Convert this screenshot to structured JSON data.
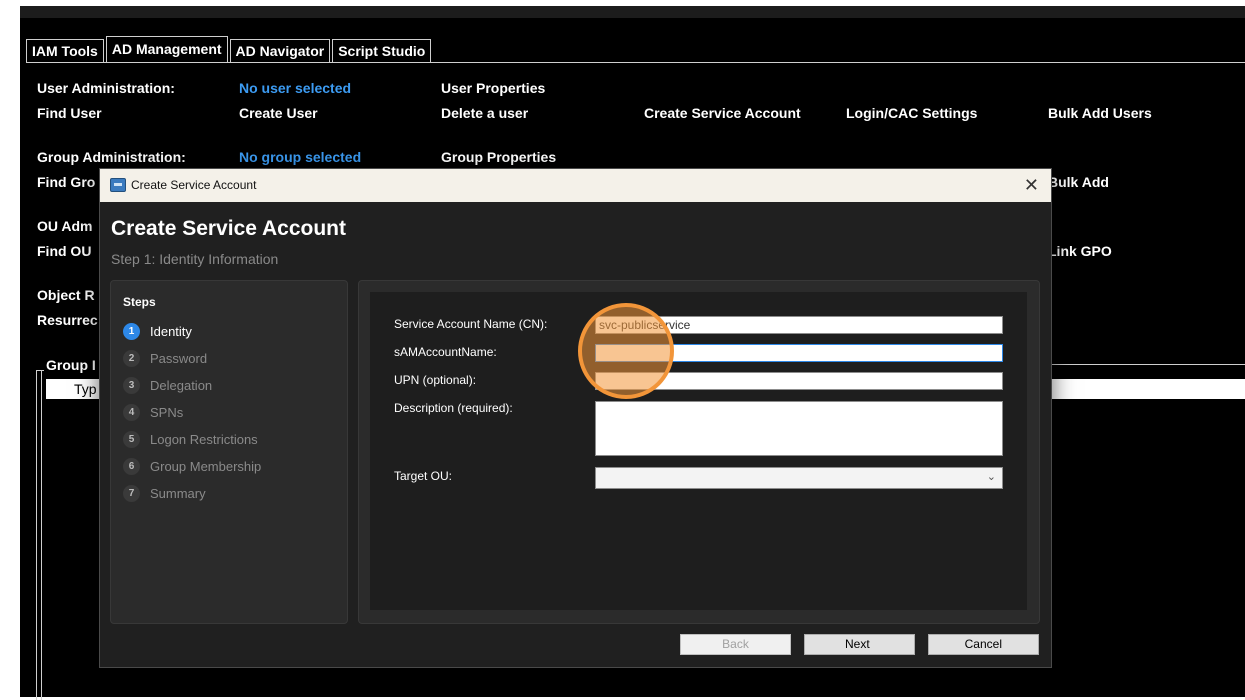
{
  "tabs": [
    "IAM Tools",
    "AD Management",
    "AD Navigator",
    "Script Studio"
  ],
  "active_tab": "AD Management",
  "user_admin": {
    "heading": "User Administration:",
    "status": "No user selected",
    "properties": "User Properties",
    "actions": [
      "Find User",
      "Create User",
      "Delete a user",
      "Create Service Account",
      "Login/CAC Settings",
      "Bulk Add Users"
    ]
  },
  "group_admin": {
    "heading": "Group Administration:",
    "status": "No group selected",
    "properties": "Group Properties",
    "find": "Find Gro",
    "bulk": "Bulk Add"
  },
  "ou_admin": {
    "heading": "OU Adm",
    "find": "Find OU",
    "link_gpo": "Link GPO"
  },
  "object_admin": {
    "heading": "Object R",
    "resurrect": "Resurrec"
  },
  "group_box": {
    "title": "Group I",
    "column": "Typ"
  },
  "dialog": {
    "window_title": "Create Service Account",
    "heading": "Create Service Account",
    "subheading": "Step 1: Identity Information",
    "steps_title": "Steps",
    "steps": [
      {
        "num": "1",
        "label": "Identity"
      },
      {
        "num": "2",
        "label": "Password"
      },
      {
        "num": "3",
        "label": "Delegation"
      },
      {
        "num": "4",
        "label": "SPNs"
      },
      {
        "num": "5",
        "label": "Logon Restrictions"
      },
      {
        "num": "6",
        "label": "Group Membership"
      },
      {
        "num": "7",
        "label": "Summary"
      }
    ],
    "fields": {
      "cn_label": "Service Account Name (CN):",
      "cn_value": "svc-publicservice",
      "sam_label": "sAMAccountName:",
      "sam_value": "",
      "upn_label": "UPN (optional):",
      "upn_value": "",
      "desc_label": "Description (required):",
      "desc_value": "",
      "ou_label": "Target OU:",
      "ou_value": ""
    },
    "buttons": {
      "back": "Back",
      "next": "Next",
      "cancel": "Cancel"
    }
  },
  "colors": {
    "accent": "#2d88e8",
    "link_blue": "#3c9bf2",
    "cursor_highlight": "#f29539"
  }
}
